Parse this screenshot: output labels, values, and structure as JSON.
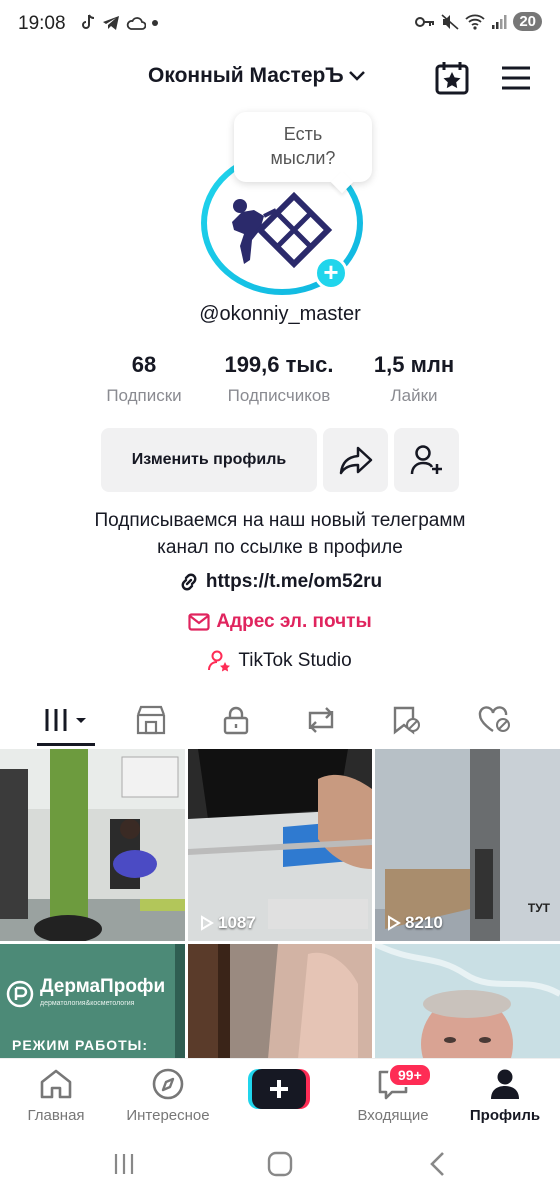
{
  "status_bar": {
    "time": "19:08",
    "battery": "20"
  },
  "header": {
    "account_name": "Оконный МастерЪ"
  },
  "avatar": {
    "thoughts_prompt": "Есть мысли?"
  },
  "profile": {
    "username": "@okonniy_master",
    "stats": [
      {
        "value": "68",
        "label": "Подписки"
      },
      {
        "value": "199,6 тыс.",
        "label": "Подписчиков"
      },
      {
        "value": "1,5 млн",
        "label": "Лайки"
      }
    ],
    "edit_button": "Изменить профиль",
    "bio_line1": "Подписываемся на наш новый телеграмм",
    "bio_line2": "канал по ссылке в профиле",
    "link": "https://t.me/om52ru",
    "email": "Адрес эл. почты",
    "studio": "TikTok Studio"
  },
  "videos": [
    {
      "views": ""
    },
    {
      "views": "1087"
    },
    {
      "views": "8210",
      "overlay": "ТУТ"
    },
    {
      "views": "",
      "overlay_brand": "ДермаПрофи",
      "overlay_sub": "дерматология&косметология",
      "overlay_hours": "РЕЖИМ РАБОТЫ:"
    },
    {
      "views": ""
    },
    {
      "views": ""
    }
  ],
  "bottom_nav": {
    "home": "Главная",
    "discover": "Интересное",
    "inbox": "Входящие",
    "inbox_badge": "99+",
    "profile": "Профиль"
  },
  "colors": {
    "accent_pink": "#fe2c55",
    "accent_cyan": "#20d5ec",
    "email_red": "#e0245e"
  }
}
